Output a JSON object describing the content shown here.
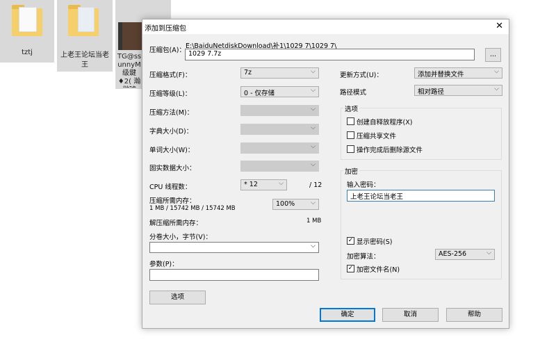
{
  "desktop": {
    "items": [
      {
        "label": "tztj"
      },
      {
        "label": "上老王论坛当老王"
      },
      {
        "label": "TG@ss unnyM 级鍵♦2( 瀚傚璩"
      }
    ]
  },
  "dialog": {
    "title": "添加到压缩包",
    "archive_label": "压缩包(A)：",
    "archive_path": "E:\\BaiduNetdiskDownload\\补1\\1029 7\\1029 7\\",
    "archive_name": "1029 7.7z",
    "browse_label": "...",
    "format_label": "压缩格式(F)：",
    "format_value": "7z",
    "level_label": "压缩等级(L)：",
    "level_value": "0 - 仅存储",
    "method_label": "压缩方法(M)：",
    "dict_label": "字典大小(D)：",
    "word_label": "单词大小(W)：",
    "solid_label": "固实数据大小：",
    "cpu_label": "CPU 线程数：",
    "cpu_value": "* 12",
    "cpu_max": "/ 12",
    "mem_label": "压缩所需内存：",
    "mem_value": "1 MB / 15742 MB / 15742 MB",
    "mem_pct": "100%",
    "decomp_label": "解压缩所需内存：",
    "decomp_value": "1 MB",
    "volume_label": "分卷大小，字节(V)：",
    "volume_value": "",
    "params_label": "参数(P)：",
    "params_value": "",
    "options_button": "选项",
    "update_label": "更新方式(U)：",
    "update_value": "添加并替换文件",
    "path_label": "路径模式",
    "path_value": "相对路径",
    "options_group": "选项",
    "opt_sfx": "创建自释放程序(X)",
    "opt_shared": "压缩共享文件",
    "opt_delete": "操作完成后删除源文件",
    "enc_group": "加密",
    "pwd_label": "输入密码：",
    "pwd_value": "上老王论坛当老王",
    "show_pwd": "显示密码(S)",
    "enc_method_label": "加密算法：",
    "enc_method_value": "AES-256",
    "enc_names": "加密文件名(N)",
    "ok": "确定",
    "cancel": "取消",
    "help": "帮助"
  }
}
